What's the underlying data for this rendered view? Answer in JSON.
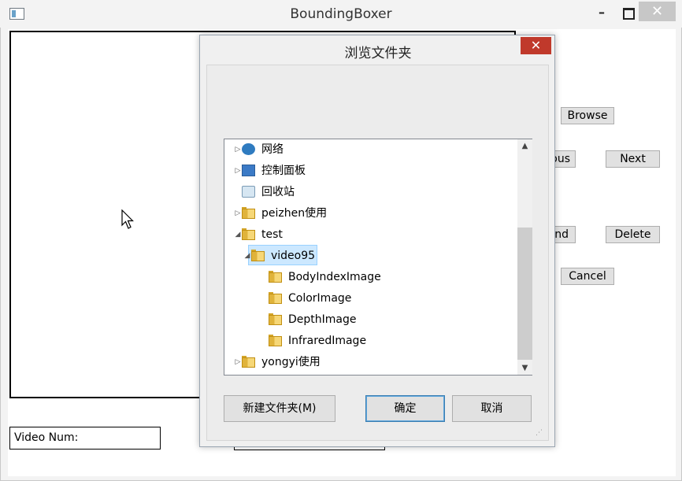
{
  "window": {
    "title": "BoundingBoxer",
    "minimize": "–",
    "close": "✕"
  },
  "main": {
    "browse": "Browse",
    "previous_partial": "ous",
    "next": "Next",
    "find_partial": "nd",
    "delete": "Delete",
    "cancel": "Cancel",
    "video_num_label": "Video Num:"
  },
  "dialog": {
    "title": "浏览文件夹",
    "close": "✕",
    "tree": [
      {
        "label": "网络",
        "icon": "network-icon",
        "arrow": "▷",
        "level": 0
      },
      {
        "label": "控制面板",
        "icon": "control-panel-icon",
        "arrow": "▷",
        "level": 0
      },
      {
        "label": "回收站",
        "icon": "recycle-bin-icon",
        "arrow": "",
        "level": 0
      },
      {
        "label": "peizhen使用",
        "icon": "folder-icon",
        "arrow": "▷",
        "level": 0
      },
      {
        "label": "test",
        "icon": "folder-icon",
        "arrow": "◢",
        "level": 0
      },
      {
        "label": "video95",
        "icon": "folder-icon",
        "arrow": "◢",
        "level": 1,
        "selected": true
      },
      {
        "label": "BodyIndexImage",
        "icon": "folder-icon",
        "arrow": "",
        "level": 2
      },
      {
        "label": "ColorImage",
        "icon": "folder-icon",
        "arrow": "",
        "level": 2
      },
      {
        "label": "DepthImage",
        "icon": "folder-icon",
        "arrow": "",
        "level": 2
      },
      {
        "label": "InfraredImage",
        "icon": "folder-icon",
        "arrow": "",
        "level": 2
      },
      {
        "label": "yongyi使用",
        "icon": "folder-icon",
        "arrow": "▷",
        "level": 0
      }
    ],
    "new_folder": "新建文件夹(M)",
    "ok": "确定",
    "cancel": "取消"
  },
  "colors": {
    "dialog_close_bg": "#c0392b",
    "selection_bg": "#cce8ff",
    "selection_border": "#99d1ff",
    "ok_border": "#3c7fb1"
  }
}
